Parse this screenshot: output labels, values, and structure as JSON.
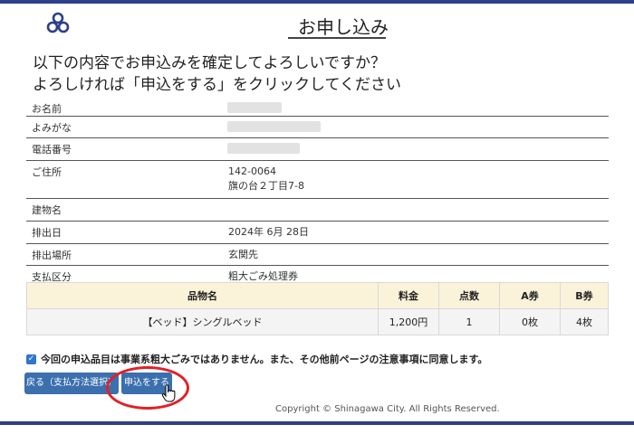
{
  "header": {
    "title": "お申し込み",
    "colors": {
      "accent": "#2d3f8c",
      "button": "#3b6fae",
      "highlight": "#e21f26",
      "table_header": "#fbf3d9"
    }
  },
  "question": {
    "line1": "以下の内容でお申込みを確定してよろしいですか？",
    "line2": "よろしければ「申込をする」をクリックしてください"
  },
  "info": {
    "name_label": "お名前",
    "kana_label": "よみがな",
    "phone_label": "電話番号",
    "address_label": "ご住所",
    "postal": "142-0064",
    "address": "旗の台２丁目7-8",
    "building_label": "建物名",
    "date_label": "排出日",
    "date": "2024年 6月 28日",
    "place_label": "排出場所",
    "place": "玄関先",
    "payment_label": "支払区分",
    "payment": "粗大ごみ処理券"
  },
  "items_table": {
    "headers": {
      "item": "品物名",
      "price": "料金",
      "count": "点数",
      "a_ticket": "A券",
      "b_ticket": "B券"
    },
    "rows": [
      {
        "item": "【ベッド】シングルベッド",
        "price": "1,200円",
        "count": "1",
        "a_ticket": "0枚",
        "b_ticket": "4枚"
      }
    ]
  },
  "agreement": {
    "checked": true,
    "text": "今回の申込品目は事業系粗大ごみではありません。また、その他前ページの注意事項に同意します。"
  },
  "buttons": {
    "back": "戻る（支払方法選択）",
    "apply": "申込をする"
  },
  "footer": {
    "copyright": "Copyright © Shinagawa City. All Rights Reserved."
  }
}
